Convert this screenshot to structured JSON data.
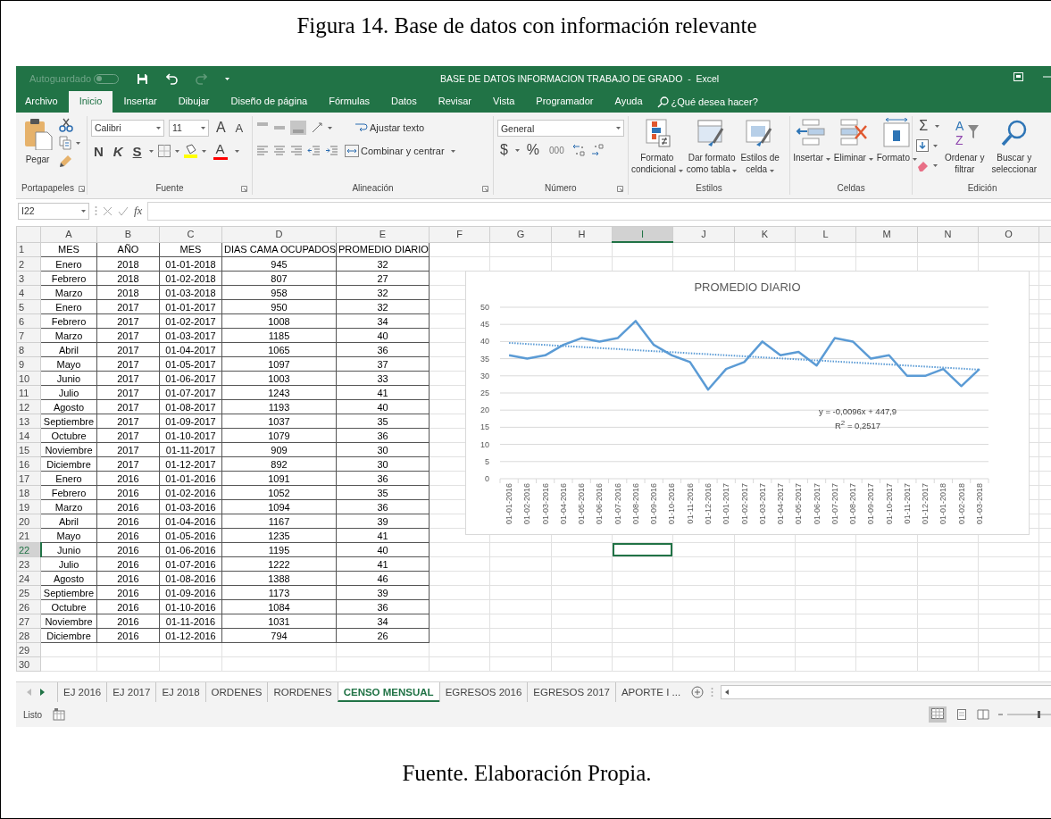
{
  "figure_caption": "Figura 14. Base de datos con información relevante",
  "window": {
    "autosave_label": "Autoguardado",
    "autosave_on": false,
    "title": "BASE DE DATOS INFORMACION TRABAJO DE GRADO  -  Excel",
    "redo_disabled": true
  },
  "ribbon_tabs": [
    {
      "label": "Archivo",
      "selected": false
    },
    {
      "label": "Inicio",
      "selected": true
    },
    {
      "label": "Insertar",
      "selected": false
    },
    {
      "label": "Dibujar",
      "selected": false
    },
    {
      "label": "Diseño de página",
      "selected": false
    },
    {
      "label": "Fórmulas",
      "selected": false
    },
    {
      "label": "Datos",
      "selected": false
    },
    {
      "label": "Revisar",
      "selected": false
    },
    {
      "label": "Vista",
      "selected": false
    },
    {
      "label": "Programador",
      "selected": false
    },
    {
      "label": "Ayuda",
      "selected": false
    }
  ],
  "tell_me": "¿Qué desea hacer?",
  "ribbon": {
    "clipboard": {
      "label": "Portapapeles",
      "paste": "Pegar"
    },
    "font": {
      "label": "Fuente",
      "font_name": "Calibri",
      "font_size": "11",
      "grow": "A",
      "shrink": "A",
      "bold": "N",
      "italic": "K",
      "underline": "S",
      "font_color": "A"
    },
    "alignment": {
      "label": "Alineación",
      "wrap_text": "Ajustar texto",
      "merge_center": "Combinar y centrar"
    },
    "number": {
      "label": "Número",
      "format": "General",
      "currency": "$",
      "percent": "%",
      "thousands": "000"
    },
    "styles": {
      "label": "Estilos",
      "buttons": [
        {
          "lines": [
            "Formato",
            "condicional"
          ]
        },
        {
          "lines": [
            "Dar formato",
            "como tabla"
          ]
        },
        {
          "lines": [
            "Estilos de",
            "celda"
          ]
        }
      ]
    },
    "cells": {
      "label": "Celdas",
      "buttons": [
        {
          "lines": [
            "Insertar"
          ]
        },
        {
          "lines": [
            "Eliminar"
          ]
        },
        {
          "lines": [
            "Formato"
          ]
        }
      ]
    },
    "editing": {
      "label": "Edición",
      "autosum": "Σ",
      "sort_letters": [
        "A",
        "Z"
      ],
      "buttons": [
        {
          "lines": [
            "Ordenar y",
            "filtrar"
          ]
        },
        {
          "lines": [
            "Buscar y",
            "seleccionar"
          ]
        }
      ]
    }
  },
  "formula_bar": {
    "name_box": "I22",
    "fx": "fx"
  },
  "columns": [
    {
      "label": "A",
      "selected": false
    },
    {
      "label": "B",
      "selected": false
    },
    {
      "label": "C",
      "selected": false
    },
    {
      "label": "D",
      "selected": false
    },
    {
      "label": "E",
      "selected": false
    },
    {
      "label": "F",
      "selected": false
    },
    {
      "label": "G",
      "selected": false
    },
    {
      "label": "H",
      "selected": false
    },
    {
      "label": "I",
      "selected": true
    },
    {
      "label": "J",
      "selected": false
    },
    {
      "label": "K",
      "selected": false
    },
    {
      "label": "L",
      "selected": false
    },
    {
      "label": "M",
      "selected": false
    },
    {
      "label": "N",
      "selected": false
    },
    {
      "label": "O",
      "selected": false
    }
  ],
  "rows": [
    {
      "number": "1",
      "selected": false,
      "cells": [
        "MES",
        "AÑO",
        "MES",
        "DIAS CAMA OCUPADOS",
        "PROMEDIO DIARIO"
      ]
    },
    {
      "number": "2",
      "selected": false,
      "cells": [
        "Enero",
        "2018",
        "01-01-2018",
        "945",
        "32"
      ]
    },
    {
      "number": "3",
      "selected": false,
      "cells": [
        "Febrero",
        "2018",
        "01-02-2018",
        "807",
        "27"
      ]
    },
    {
      "number": "4",
      "selected": false,
      "cells": [
        "Marzo",
        "2018",
        "01-03-2018",
        "958",
        "32"
      ]
    },
    {
      "number": "5",
      "selected": false,
      "cells": [
        "Enero",
        "2017",
        "01-01-2017",
        "950",
        "32"
      ]
    },
    {
      "number": "6",
      "selected": false,
      "cells": [
        "Febrero",
        "2017",
        "01-02-2017",
        "1008",
        "34"
      ]
    },
    {
      "number": "7",
      "selected": false,
      "cells": [
        "Marzo",
        "2017",
        "01-03-2017",
        "1185",
        "40"
      ]
    },
    {
      "number": "8",
      "selected": false,
      "cells": [
        "Abril",
        "2017",
        "01-04-2017",
        "1065",
        "36"
      ]
    },
    {
      "number": "9",
      "selected": false,
      "cells": [
        "Mayo",
        "2017",
        "01-05-2017",
        "1097",
        "37"
      ]
    },
    {
      "number": "10",
      "selected": false,
      "cells": [
        "Junio",
        "2017",
        "01-06-2017",
        "1003",
        "33"
      ]
    },
    {
      "number": "11",
      "selected": false,
      "cells": [
        "Julio",
        "2017",
        "01-07-2017",
        "1243",
        "41"
      ]
    },
    {
      "number": "12",
      "selected": false,
      "cells": [
        "Agosto",
        "2017",
        "01-08-2017",
        "1193",
        "40"
      ]
    },
    {
      "number": "13",
      "selected": false,
      "cells": [
        "Septiembre",
        "2017",
        "01-09-2017",
        "1037",
        "35"
      ]
    },
    {
      "number": "14",
      "selected": false,
      "cells": [
        "Octubre",
        "2017",
        "01-10-2017",
        "1079",
        "36"
      ]
    },
    {
      "number": "15",
      "selected": false,
      "cells": [
        "Noviembre",
        "2017",
        "01-11-2017",
        "909",
        "30"
      ]
    },
    {
      "number": "16",
      "selected": false,
      "cells": [
        "Diciembre",
        "2017",
        "01-12-2017",
        "892",
        "30"
      ]
    },
    {
      "number": "17",
      "selected": false,
      "cells": [
        "Enero",
        "2016",
        "01-01-2016",
        "1091",
        "36"
      ]
    },
    {
      "number": "18",
      "selected": false,
      "cells": [
        "Febrero",
        "2016",
        "01-02-2016",
        "1052",
        "35"
      ]
    },
    {
      "number": "19",
      "selected": false,
      "cells": [
        "Marzo",
        "2016",
        "01-03-2016",
        "1094",
        "36"
      ]
    },
    {
      "number": "20",
      "selected": false,
      "cells": [
        "Abril",
        "2016",
        "01-04-2016",
        "1167",
        "39"
      ]
    },
    {
      "number": "21",
      "selected": false,
      "cells": [
        "Mayo",
        "2016",
        "01-05-2016",
        "1235",
        "41"
      ]
    },
    {
      "number": "22",
      "selected": true,
      "cells": [
        "Junio",
        "2016",
        "01-06-2016",
        "1195",
        "40"
      ]
    },
    {
      "number": "23",
      "selected": false,
      "cells": [
        "Julio",
        "2016",
        "01-07-2016",
        "1222",
        "41"
      ]
    },
    {
      "number": "24",
      "selected": false,
      "cells": [
        "Agosto",
        "2016",
        "01-08-2016",
        "1388",
        "46"
      ]
    },
    {
      "number": "25",
      "selected": false,
      "cells": [
        "Septiembre",
        "2016",
        "01-09-2016",
        "1173",
        "39"
      ]
    },
    {
      "number": "26",
      "selected": false,
      "cells": [
        "Octubre",
        "2016",
        "01-10-2016",
        "1084",
        "36"
      ]
    },
    {
      "number": "27",
      "selected": false,
      "cells": [
        "Noviembre",
        "2016",
        "01-11-2016",
        "1031",
        "34"
      ]
    },
    {
      "number": "28",
      "selected": false,
      "cells": [
        "Diciembre",
        "2016",
        "01-12-2016",
        "794",
        "26"
      ]
    },
    {
      "number": "29",
      "selected": false,
      "cells": []
    },
    {
      "number": "30",
      "selected": false,
      "cells": []
    }
  ],
  "chart": {
    "chart_data": {
      "type": "line",
      "title": "PROMEDIO DIARIO",
      "categories": [
        "01-01-2016",
        "01-02-2016",
        "01-03-2016",
        "01-04-2016",
        "01-05-2016",
        "01-06-2016",
        "01-07-2016",
        "01-08-2016",
        "01-09-2016",
        "01-10-2016",
        "01-11-2016",
        "01-12-2016",
        "01-01-2017",
        "01-02-2017",
        "01-03-2017",
        "01-04-2017",
        "01-05-2017",
        "01-06-2017",
        "01-07-2017",
        "01-08-2017",
        "01-09-2017",
        "01-10-2017",
        "01-11-2017",
        "01-12-2017",
        "01-01-2018",
        "01-02-2018",
        "01-03-2018"
      ],
      "grid": true,
      "series": [
        {
          "line_style": "solid",
          "color": "#5b9bd5",
          "values": [
            36,
            35,
            36,
            39,
            41,
            40,
            41,
            46,
            39,
            36,
            34,
            26,
            32,
            34,
            40,
            36,
            37,
            33,
            41,
            40,
            35,
            36,
            30,
            30,
            32,
            27,
            32
          ]
        },
        {
          "line_style": "dotted",
          "color": "#5b9bd5",
          "values": [
            39.6,
            39.3,
            39,
            38.7,
            38.4,
            38.1,
            37.8,
            37.5,
            37.2,
            36.9,
            36.6,
            36.3,
            36,
            35.7,
            35.4,
            35.1,
            34.8,
            34.5,
            34.2,
            33.9,
            33.6,
            33.3,
            33,
            32.7,
            32.4,
            32.1,
            31.8
          ]
        }
      ],
      "ylim": [
        0,
        50
      ],
      "yticks": [
        0,
        5,
        10,
        15,
        20,
        25,
        30,
        35,
        40,
        45,
        50
      ],
      "annotations": [
        "y = -0,0096x + 447,9",
        "R$^{2}$ = 0,2517"
      ]
    }
  },
  "sheet_tabs": [
    {
      "label": "EJ 2016",
      "selected": false
    },
    {
      "label": "EJ 2017",
      "selected": false
    },
    {
      "label": "EJ 2018",
      "selected": false
    },
    {
      "label": "ORDENES",
      "selected": false
    },
    {
      "label": "RORDENES",
      "selected": false
    },
    {
      "label": "CENSO MENSUAL",
      "selected": true
    },
    {
      "label": "EGRESOS 2016",
      "selected": false
    },
    {
      "label": "EGRESOS 2017",
      "selected": false
    },
    {
      "label": "APORTE I ...",
      "selected": false
    }
  ],
  "status_bar": {
    "status": "Listo"
  },
  "source_caption": "Fuente. Elaboración Propia."
}
